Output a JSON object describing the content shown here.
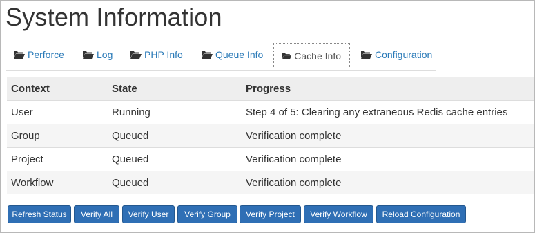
{
  "page": {
    "title": "System Information"
  },
  "tabs": [
    {
      "label": "Perforce",
      "icon": "folder-open-icon"
    },
    {
      "label": "Log",
      "icon": "folder-open-icon"
    },
    {
      "label": "PHP Info",
      "icon": "folder-open-icon"
    },
    {
      "label": "Queue Info",
      "icon": "folder-open-icon"
    },
    {
      "label": "Cache Info",
      "icon": "folder-open-icon",
      "active": true
    },
    {
      "label": "Configuration",
      "icon": "folder-open-icon"
    }
  ],
  "table": {
    "headers": [
      "Context",
      "State",
      "Progress"
    ],
    "rows": [
      [
        "User",
        "Running",
        "Step 4 of 5: Clearing any extraneous Redis cache entries"
      ],
      [
        "Group",
        "Queued",
        "Verification complete"
      ],
      [
        "Project",
        "Queued",
        "Verification complete"
      ],
      [
        "Workflow",
        "Queued",
        "Verification complete"
      ]
    ]
  },
  "buttons": {
    "refresh": "Refresh Status",
    "verify_all": "Verify All",
    "verify_user": "Verify User",
    "verify_group": "Verify Group",
    "verify_project": "Verify Project",
    "verify_workflow": "Verify Workflow",
    "reload_config": "Reload Configuration"
  },
  "colors": {
    "link": "#2a7ab8",
    "button": "#2f6fb5",
    "header_bg": "#eeeeee"
  }
}
